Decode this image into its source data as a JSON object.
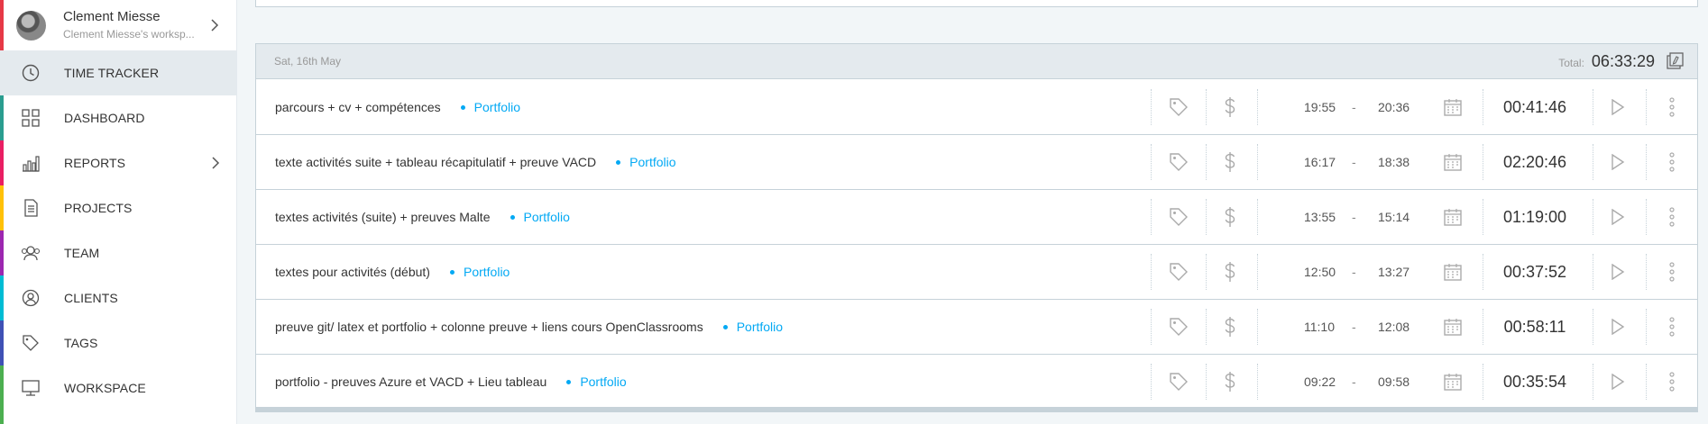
{
  "user": {
    "name": "Clement Miesse",
    "workspace": "Clement Miesse's worksp..."
  },
  "nav": [
    {
      "label": "TIME TRACKER",
      "icon": "clock-icon",
      "name": "time-tracker"
    },
    {
      "label": "DASHBOARD",
      "icon": "dashboard-icon",
      "name": "dashboard"
    },
    {
      "label": "REPORTS",
      "icon": "bar-chart-icon",
      "name": "reports"
    },
    {
      "label": "PROJECTS",
      "icon": "document-icon",
      "name": "projects"
    },
    {
      "label": "TEAM",
      "icon": "team-icon",
      "name": "team"
    },
    {
      "label": "CLIENTS",
      "icon": "person-icon",
      "name": "clients"
    },
    {
      "label": "TAGS",
      "icon": "tag-icon",
      "name": "tags"
    },
    {
      "label": "WORKSPACE",
      "icon": "monitor-icon",
      "name": "workspace"
    }
  ],
  "group": {
    "date": "Sat, 16th May",
    "total_label": "Total:",
    "total": "06:33:29"
  },
  "entries": [
    {
      "description": "parcours + cv + compétences",
      "project": "Portfolio",
      "start": "19:55",
      "sep": "-",
      "end": "20:36",
      "duration": "00:41:46"
    },
    {
      "description": "texte activités  suite + tableau récapitulatif + preuve VACD",
      "project": "Portfolio",
      "start": "16:17",
      "sep": "-",
      "end": "18:38",
      "duration": "02:20:46"
    },
    {
      "description": "textes activités (suite) + preuves Malte",
      "project": "Portfolio",
      "start": "13:55",
      "sep": "-",
      "end": "15:14",
      "duration": "01:19:00"
    },
    {
      "description": "textes pour activités (début)",
      "project": "Portfolio",
      "start": "12:50",
      "sep": "-",
      "end": "13:27",
      "duration": "00:37:52"
    },
    {
      "description": "preuve git/ latex et portfolio + colonne preuve + liens cours OpenClassrooms",
      "project": "Portfolio",
      "start": "11:10",
      "sep": "-",
      "end": "12:08",
      "duration": "00:58:11"
    },
    {
      "description": "portfolio - preuves Azure et VACD + Lieu tableau",
      "project": "Portfolio",
      "start": "09:22",
      "sep": "-",
      "end": "09:58",
      "duration": "00:35:54"
    }
  ],
  "colors": {
    "accent": "#03a9f4",
    "border": "#c6d2d9",
    "header_bg": "#e4eaee"
  }
}
